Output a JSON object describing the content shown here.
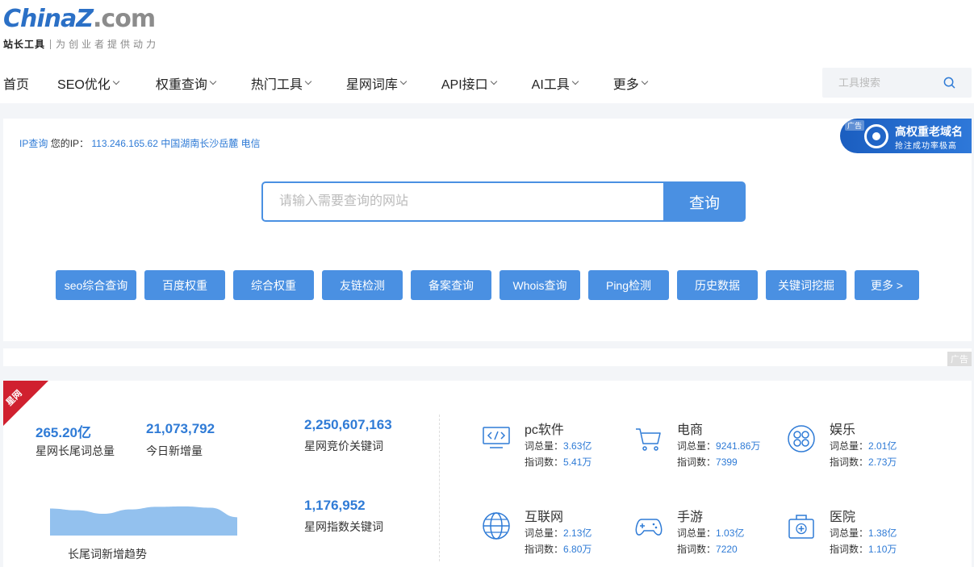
{
  "logo": {
    "part1": "China",
    "part2": "Z",
    "part3": ".com",
    "sub_title": "站长工具",
    "slogan": "为创业者提供动力"
  },
  "nav": {
    "items": [
      {
        "label": "首页",
        "dropdown": false
      },
      {
        "label": "SEO优化",
        "dropdown": true
      },
      {
        "label": "权重查询",
        "dropdown": true
      },
      {
        "label": "热门工具",
        "dropdown": true
      },
      {
        "label": "星网词库",
        "dropdown": true
      },
      {
        "label": "API接口",
        "dropdown": true
      },
      {
        "label": "AI工具",
        "dropdown": true
      },
      {
        "label": "更多",
        "dropdown": true
      }
    ],
    "search_placeholder": "工具搜索"
  },
  "ip_info": {
    "link": "IP查询",
    "label": "您的IP：",
    "value": "113.246.165.62 中国湖南长沙岳麓 电信"
  },
  "ad_banner": {
    "tag": "广告",
    "title": "高权重老域名",
    "subtitle": "抢注成功率极高"
  },
  "query": {
    "placeholder": "请输入需要查询的网站",
    "button": "查询"
  },
  "quick_buttons": [
    "seo综合查询",
    "百度权重",
    "综合权重",
    "友链检测",
    "备案查询",
    "Whois查询",
    "Ping检测",
    "历史数据",
    "关键词挖掘",
    "更多 >"
  ],
  "ad_strip": {
    "tag": "广告"
  },
  "stats": {
    "ribbon": "星网",
    "longtail_total": {
      "value": "265.20亿",
      "label": "星网长尾词总量"
    },
    "today_new": {
      "value": "21,073,792",
      "label": "今日新增量"
    },
    "bid_keywords": {
      "value": "2,250,607,163",
      "label": "星网竞价关键词"
    },
    "index_keywords": {
      "value": "1,176,952",
      "label": "星网指数关键词"
    },
    "trend_label": "长尾词新增趋势",
    "trend_values": [
      0.62,
      0.58,
      0.5,
      0.6,
      0.66,
      0.67,
      0.64,
      0.42
    ],
    "trend_color": "#93c1ee"
  },
  "categories": [
    {
      "name": "pc软件",
      "icon": "monitor-code-icon",
      "word_label": "词总量：",
      "word_value": "3.63亿",
      "index_label": "指词数：",
      "index_value": "5.41万"
    },
    {
      "name": "电商",
      "icon": "shopping-cart-icon",
      "word_label": "词总量：",
      "word_value": "9241.86万",
      "index_label": "指词数：",
      "index_value": "7399"
    },
    {
      "name": "娱乐",
      "icon": "entertainment-icon",
      "word_label": "词总量：",
      "word_value": "2.01亿",
      "index_label": "指词数：",
      "index_value": "2.73万"
    },
    {
      "name": "互联网",
      "icon": "globe-icon",
      "word_label": "词总量：",
      "word_value": "2.13亿",
      "index_label": "指词数：",
      "index_value": "6.80万"
    },
    {
      "name": "手游",
      "icon": "gamepad-icon",
      "word_label": "词总量：",
      "word_value": "1.03亿",
      "index_label": "指词数：",
      "index_value": "7220"
    },
    {
      "name": "医院",
      "icon": "medical-kit-icon",
      "word_label": "词总量：",
      "word_value": "1.38亿",
      "index_label": "指词数：",
      "index_value": "1.10万"
    }
  ]
}
